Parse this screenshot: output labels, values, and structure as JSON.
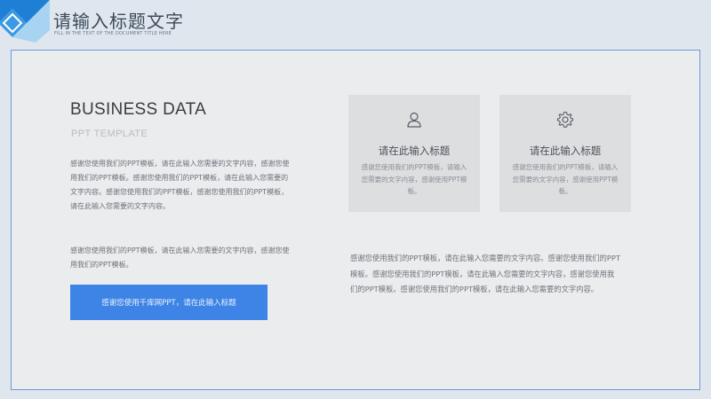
{
  "header": {
    "title": "请输入标题文字",
    "subtitle": "FILL IN THE TEXT OF THE DOCUMENT TITLE HERE"
  },
  "content": {
    "heading": "BUSINESS DATA",
    "subheading": "PPT TEMPLATE",
    "paragraph_1": "感谢您使用我们的PPT模板，请在此输入您需要的文字内容，感谢您使用我们的PPT模板。感谢您使用我们的PPT模板，请在此输入您需要的文字内容。感谢您使用我们的PPT模板，感谢您使用我们的PPT模板，请在此输入您需要的文字内容。",
    "paragraph_2": "感谢您使用我们的PPT模板，请在此输入您需要的文字内容，感谢您使用我们的PPT模板。",
    "button_label": "感谢您使用千库网PPT，请在此输入标题",
    "features": [
      {
        "icon": "user-icon",
        "title": "请在此输入标题",
        "desc": "感谢您使用我们的PPT模板，请输入您需要的文字内容，感谢使用PPT模板。"
      },
      {
        "icon": "gear-icon",
        "title": "请在此输入标题",
        "desc": "感谢您使用我们的PPT模板，请输入您需要的文字内容，感谢使用PPT模板。"
      }
    ],
    "paragraph_right": "感谢您使用我们的PPT模板，请在此输入您需要的文字内容。感谢您使用我们的PPT模板。感谢您使用我们的PPT模板，请在此输入您需要的文字内容，感谢您使用我们的PPT模板。感谢您使用我们的PPT模板，请在此输入您需要的文字内容。"
  },
  "colors": {
    "accent": "#3d84e6",
    "frame": "#6a9ad3",
    "background": "#dfe6ee"
  }
}
